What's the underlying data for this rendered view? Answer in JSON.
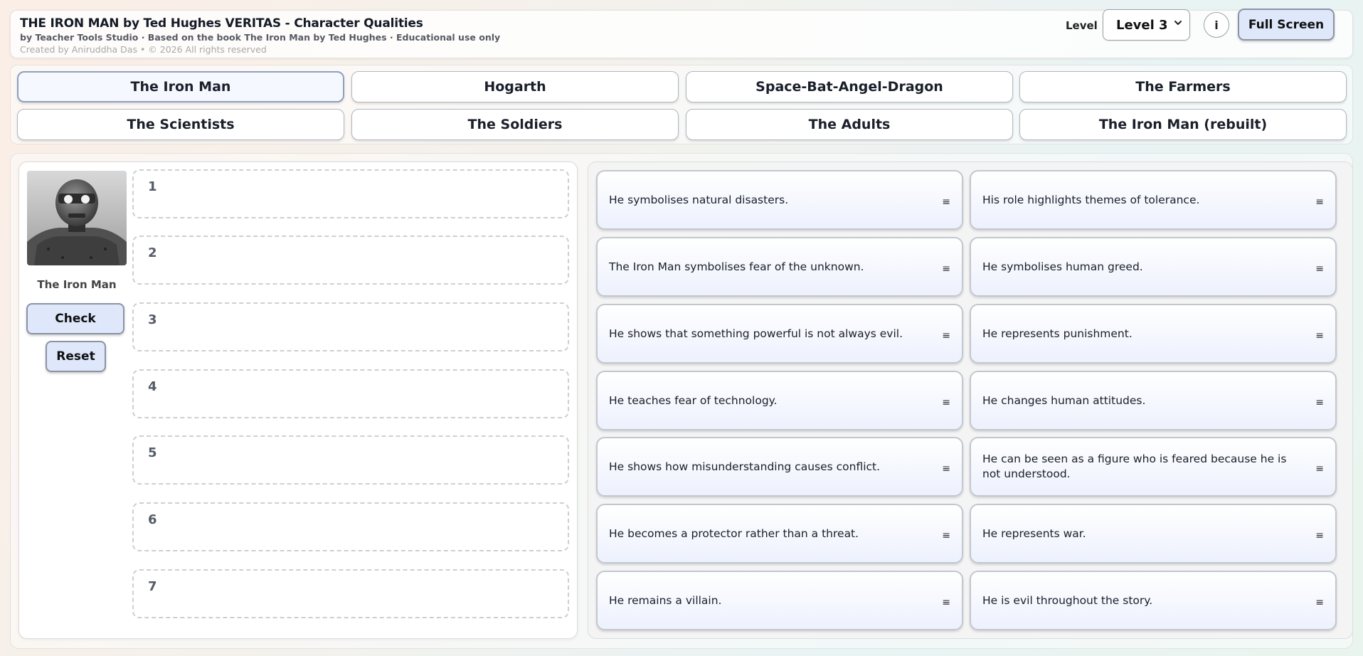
{
  "header": {
    "title": "THE IRON MAN by Ted Hughes VERITAS - Character Qualities",
    "subtitle": "by Teacher Tools Studio · Based on the book The Iron Man by Ted Hughes · Educational use only",
    "credit": "Created by Aniruddha Das • © 2026 All rights reserved",
    "level_label": "Level",
    "level_value": "Level 3",
    "info_label": "i",
    "fullscreen_label": "Full Screen"
  },
  "tabs": [
    {
      "label": "The Iron Man",
      "active": true
    },
    {
      "label": "Hogarth"
    },
    {
      "label": "Space-Bat-Angel-Dragon"
    },
    {
      "label": "The Farmers"
    },
    {
      "label": "The Scientists"
    },
    {
      "label": "The Soldiers"
    },
    {
      "label": "The Adults"
    },
    {
      "label": "The Iron Man (rebuilt)"
    }
  ],
  "character": {
    "name": "The Iron Man",
    "check_label": "Check",
    "reset_label": "Reset"
  },
  "slots": [
    "1",
    "2",
    "3",
    "4",
    "5",
    "6",
    "7"
  ],
  "items": [
    {
      "text": "He symbolises natural disasters."
    },
    {
      "text": "His role highlights themes of tolerance."
    },
    {
      "text": "The Iron Man symbolises fear of the unknown."
    },
    {
      "text": "He symbolises human greed."
    },
    {
      "text": "He shows that something powerful is not always evil."
    },
    {
      "text": "He represents punishment."
    },
    {
      "text": "He teaches fear of technology."
    },
    {
      "text": "He changes human attitudes."
    },
    {
      "text": "He shows how misunderstanding causes conflict."
    },
    {
      "text": "He can be seen as a figure who is feared because he is not understood."
    },
    {
      "text": "He becomes a protector rather than a threat."
    },
    {
      "text": "He represents war."
    },
    {
      "text": "He remains a villain."
    },
    {
      "text": "He is evil throughout the story."
    }
  ],
  "icons": {
    "drag_handle": "≡",
    "dropdown": "chevron-down-icon"
  }
}
